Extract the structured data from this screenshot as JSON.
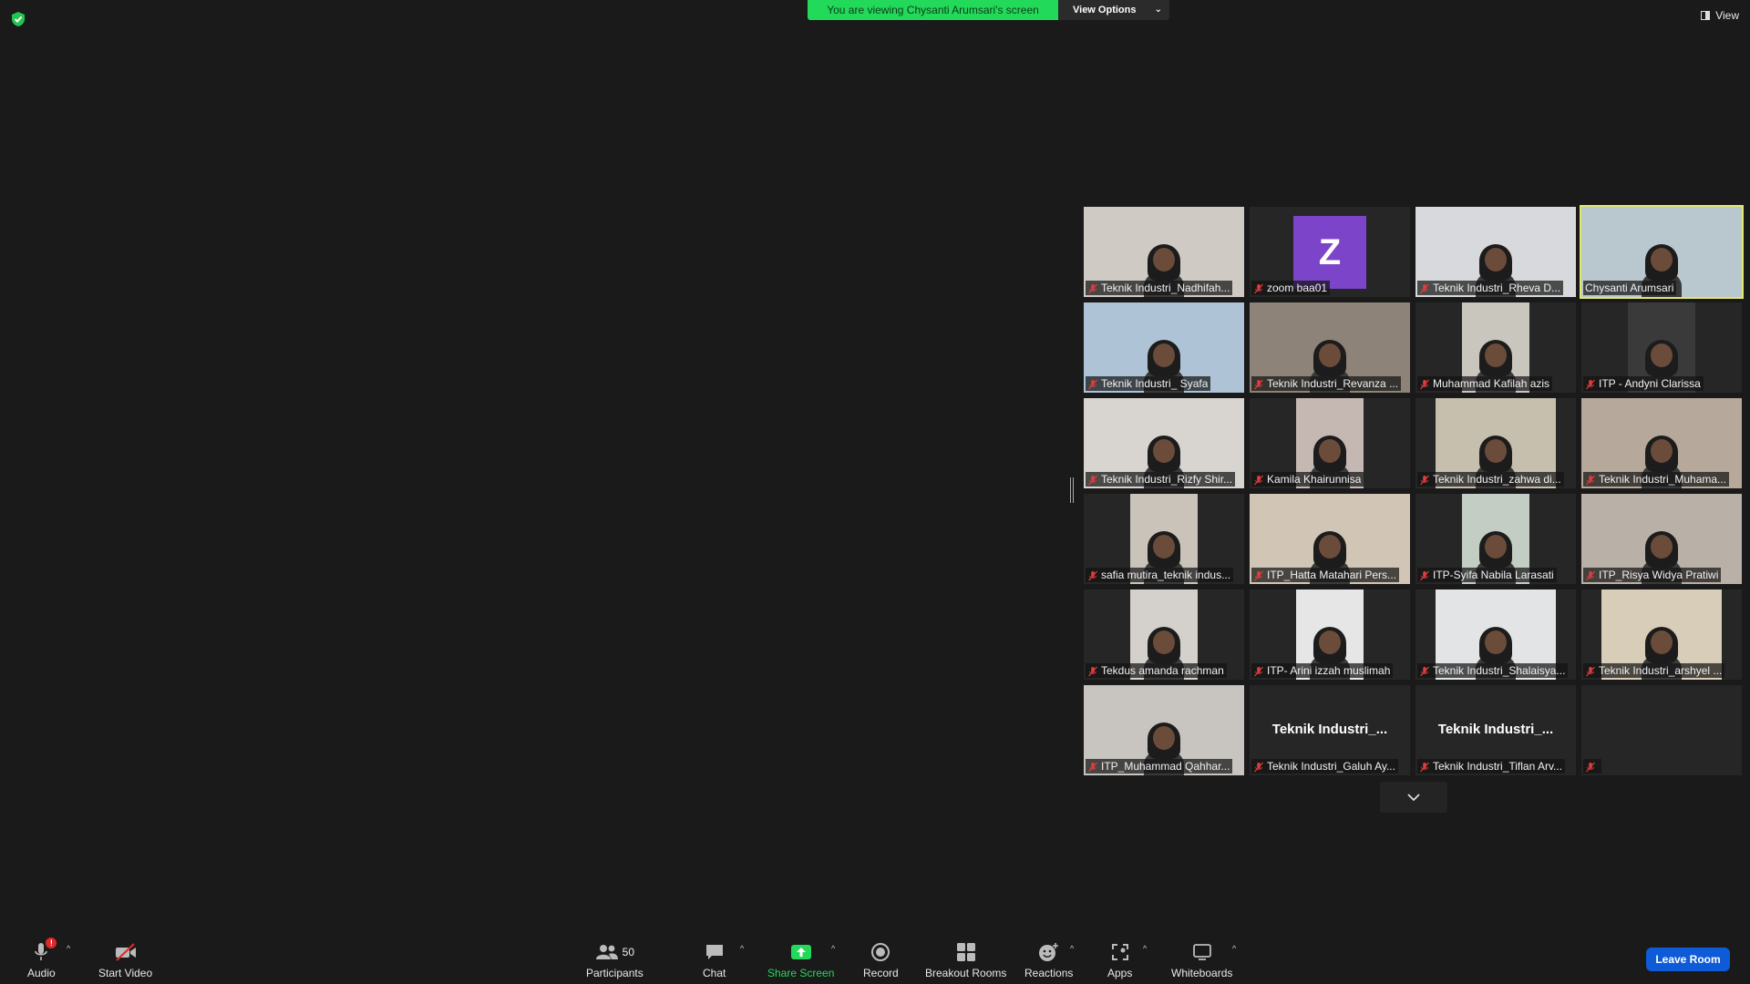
{
  "top": {
    "banner_text": "You are viewing Chysanti Arumsari's screen",
    "view_options_label": "View Options",
    "view_label": "View"
  },
  "colors": {
    "banner_green": "#23d959",
    "active_speaker_outline": "#e2e86b",
    "avatar_purple": "#7b44c9",
    "leave_blue": "#0e5bd8"
  },
  "gallery": [
    {
      "name": "Teknik Industri_Nadhifah...",
      "kind": "video",
      "bg": "#cfcac4",
      "muted": true
    },
    {
      "name": "zoom baa01",
      "kind": "avatar",
      "letter": "Z",
      "muted": true
    },
    {
      "name": "Teknik Industri_Rheva D...",
      "kind": "video",
      "bg": "#d7d9dc",
      "muted": true
    },
    {
      "name": "Chysanti Arumsari",
      "kind": "video",
      "bg": "#b9c7cf",
      "muted": false,
      "active": true
    },
    {
      "name": "Teknik Industri_ Syafa",
      "kind": "video",
      "bg": "#aec4d6",
      "muted": true
    },
    {
      "name": "Teknik Industri_Revanza ...",
      "kind": "video",
      "bg": "#8d8378",
      "muted": true
    },
    {
      "name": "Muhammad Kafilah azis",
      "kind": "video-narrow",
      "bg": "#c9c6bd",
      "muted": true
    },
    {
      "name": "ITP - Andyni Clarissa",
      "kind": "video-narrow",
      "bg": "#3a3a3a",
      "muted": true
    },
    {
      "name": "Teknik Industri_Rizfy Shir...",
      "kind": "video",
      "bg": "#d8d4cf",
      "muted": true
    },
    {
      "name": "Kamila Khairunnisa",
      "kind": "video-narrow",
      "bg": "#c5b8b2",
      "muted": true
    },
    {
      "name": "Teknik Industri_zahwa di...",
      "kind": "video-mid",
      "bg": "#c6bfae",
      "muted": true
    },
    {
      "name": "Teknik Industri_Muhama...",
      "kind": "video",
      "bg": "#b6a89a",
      "muted": true
    },
    {
      "name": "safia mutira_teknik indus...",
      "kind": "video-narrow",
      "bg": "#c9c3b9",
      "muted": true
    },
    {
      "name": "ITP_Hatta Matahari Pers...",
      "kind": "video",
      "bg": "#d1c5b5",
      "muted": true
    },
    {
      "name": "ITP-Syifa Nabila Larasati",
      "kind": "video-narrow",
      "bg": "#c3cdc4",
      "muted": true
    },
    {
      "name": "ITP_Risya Widya Pratiwi",
      "kind": "video",
      "bg": "#b9b0a8",
      "muted": true
    },
    {
      "name": "Tekdus amanda rachman",
      "kind": "video-narrow",
      "bg": "#d4d1cc",
      "muted": true
    },
    {
      "name": "ITP- Arini izzah muslimah",
      "kind": "video-narrow",
      "bg": "#e6e6e6",
      "muted": true
    },
    {
      "name": "Teknik Industri_Shalaisya...",
      "kind": "video-mid",
      "bg": "#e2e4e6",
      "muted": true
    },
    {
      "name": "Teknik Industri_arshyel ...",
      "kind": "video-mid",
      "bg": "#d8cdb8",
      "muted": true
    },
    {
      "name": "ITP_Muhammad Qahhar...",
      "kind": "video",
      "bg": "#c8c4bf",
      "muted": true
    },
    {
      "name": "Teknik Industri_Galuh Ay...",
      "kind": "name",
      "display": "Teknik  Industri_...",
      "muted": true
    },
    {
      "name": "Teknik Industri_Tiflan Arv...",
      "kind": "name",
      "display": "Teknik  Industri_...",
      "muted": true
    },
    {
      "name": "",
      "kind": "empty",
      "muted": true
    }
  ],
  "toolbar": {
    "audio_label": "Audio",
    "audio_badge": "!",
    "video_label": "Start Video",
    "participants_label": "Participants",
    "participants_count": "50",
    "chat_label": "Chat",
    "share_label": "Share Screen",
    "record_label": "Record",
    "breakout_label": "Breakout Rooms",
    "reactions_label": "Reactions",
    "apps_label": "Apps",
    "whiteboards_label": "Whiteboards",
    "leave_label": "Leave Room"
  },
  "icons": {
    "security": "shield-check-icon",
    "mute": "mic-muted-icon",
    "more": "chevron-down-icon"
  }
}
